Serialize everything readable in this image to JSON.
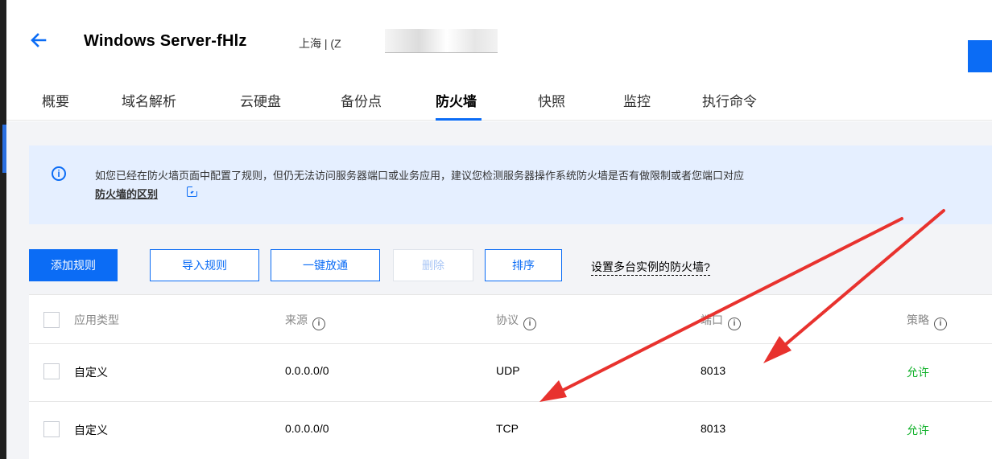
{
  "header": {
    "back_icon": "arrow-left-icon",
    "server_name": "Windows Server-fHlz",
    "region": "上海 | (Z"
  },
  "tabs": [
    {
      "label": "概要",
      "active": false
    },
    {
      "label": "域名解析",
      "active": false
    },
    {
      "label": "云硬盘",
      "active": false
    },
    {
      "label": "备份点",
      "active": false
    },
    {
      "label": "防火墙",
      "active": true
    },
    {
      "label": "快照",
      "active": false
    },
    {
      "label": "监控",
      "active": false
    },
    {
      "label": "执行命令",
      "active": false
    }
  ],
  "notice": {
    "icon": "info-icon",
    "text": "如您已经在防火墙页面中配置了规则，但仍无法访问服务器端口或业务应用，建议您检测服务器操作系统防火墙是否有做限制或者您端口对应",
    "link": "防火墙的区别",
    "link_icon": "external-link-icon"
  },
  "toolbar": {
    "add_rule": "添加规则",
    "import_rule": "导入规则",
    "one_click": "一键放通",
    "delete": "删除",
    "sort": "排序",
    "multi_instance": "设置多台实例的防火墙?"
  },
  "table": {
    "headers": {
      "type": "应用类型",
      "source": "来源",
      "protocol": "协议",
      "port": "端口",
      "policy": "策略"
    },
    "rows": [
      {
        "type": "自定义",
        "source": "0.0.0.0/0",
        "protocol": "UDP",
        "port": "8013",
        "policy": "允许"
      },
      {
        "type": "自定义",
        "source": "0.0.0.0/0",
        "protocol": "TCP",
        "port": "8013",
        "policy": "允许"
      }
    ]
  },
  "colors": {
    "accent": "#0b6cf5",
    "allow": "#12b12b",
    "annotation_arrow": "#e8322e"
  }
}
